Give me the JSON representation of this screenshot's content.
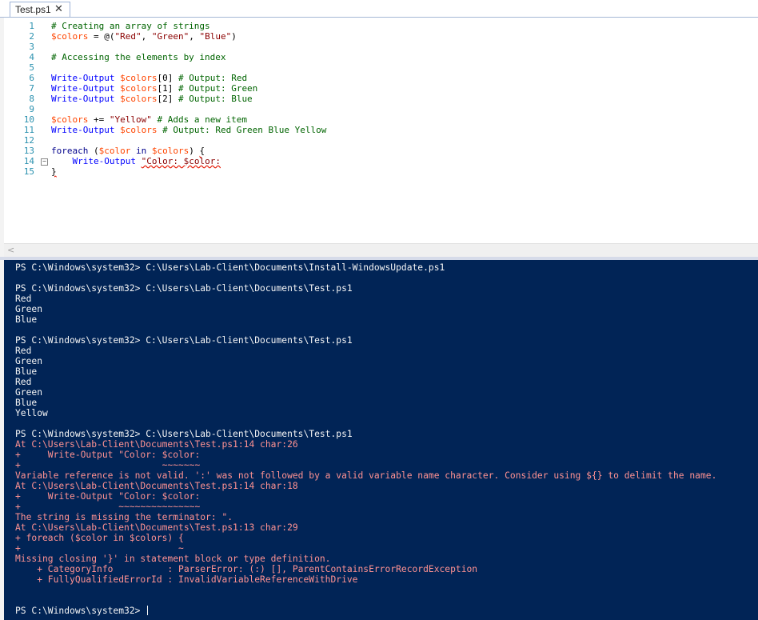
{
  "tab": {
    "label": "Test.ps1",
    "close_glyph": "✕"
  },
  "editor": {
    "line_numbers": [
      "1",
      "2",
      "3",
      "4",
      "5",
      "6",
      "7",
      "8",
      "9",
      "10",
      "11",
      "12",
      "13",
      "14",
      "15"
    ],
    "lines": [
      [
        {
          "t": "# Creating an array of strings",
          "c": "comment"
        }
      ],
      [
        {
          "t": "$colors",
          "c": "var"
        },
        {
          "t": " = @(",
          "c": "plain"
        },
        {
          "t": "\"Red\"",
          "c": "str"
        },
        {
          "t": ", ",
          "c": "plain"
        },
        {
          "t": "\"Green\"",
          "c": "str"
        },
        {
          "t": ", ",
          "c": "plain"
        },
        {
          "t": "\"Blue\"",
          "c": "str"
        },
        {
          "t": ")",
          "c": "plain"
        }
      ],
      [],
      [
        {
          "t": "# Accessing the elements by index",
          "c": "comment"
        }
      ],
      [],
      [
        {
          "t": "Write-Output",
          "c": "cmd"
        },
        {
          "t": " ",
          "c": "plain"
        },
        {
          "t": "$colors",
          "c": "var"
        },
        {
          "t": "[0] ",
          "c": "plain"
        },
        {
          "t": "# Output: Red",
          "c": "comment"
        }
      ],
      [
        {
          "t": "Write-Output",
          "c": "cmd"
        },
        {
          "t": " ",
          "c": "plain"
        },
        {
          "t": "$colors",
          "c": "var"
        },
        {
          "t": "[1] ",
          "c": "plain"
        },
        {
          "t": "# Output: Green",
          "c": "comment"
        }
      ],
      [
        {
          "t": "Write-Output",
          "c": "cmd"
        },
        {
          "t": " ",
          "c": "plain"
        },
        {
          "t": "$colors",
          "c": "var"
        },
        {
          "t": "[2] ",
          "c": "plain"
        },
        {
          "t": "# Output: Blue",
          "c": "comment"
        }
      ],
      [],
      [
        {
          "t": "$colors",
          "c": "var"
        },
        {
          "t": " += ",
          "c": "plain"
        },
        {
          "t": "\"Yellow\"",
          "c": "str"
        },
        {
          "t": " ",
          "c": "plain"
        },
        {
          "t": "# Adds a new item",
          "c": "comment"
        }
      ],
      [
        {
          "t": "Write-Output",
          "c": "cmd"
        },
        {
          "t": " ",
          "c": "plain"
        },
        {
          "t": "$colors",
          "c": "var"
        },
        {
          "t": " ",
          "c": "plain"
        },
        {
          "t": "# Output: Red Green Blue Yellow",
          "c": "comment"
        }
      ],
      [],
      [
        {
          "t": "foreach",
          "c": "kw"
        },
        {
          "t": " (",
          "c": "plain"
        },
        {
          "t": "$color",
          "c": "var"
        },
        {
          "t": " ",
          "c": "plain"
        },
        {
          "t": "in",
          "c": "kw"
        },
        {
          "t": " ",
          "c": "plain"
        },
        {
          "t": "$colors",
          "c": "var"
        },
        {
          "t": ") ",
          "c": "plain"
        },
        {
          "t": "{",
          "c": "err"
        }
      ],
      [
        {
          "t": "    ",
          "c": "plain"
        },
        {
          "t": "Write-Output",
          "c": "cmd"
        },
        {
          "t": " ",
          "c": "plain"
        },
        {
          "t": "\"Color: $color:",
          "c": "strerr"
        }
      ],
      [
        {
          "t": "}",
          "c": "err"
        }
      ]
    ],
    "fold_glyph": "−"
  },
  "scroll": {
    "left_arrow": "<"
  },
  "console": {
    "lines": [
      {
        "t": "PS C:\\Windows\\system32> C:\\Users\\Lab-Client\\Documents\\Install-WindowsUpdate.ps1",
        "k": "out"
      },
      {
        "t": "",
        "k": "out"
      },
      {
        "t": "PS C:\\Windows\\system32> C:\\Users\\Lab-Client\\Documents\\Test.ps1",
        "k": "out"
      },
      {
        "t": "Red",
        "k": "out"
      },
      {
        "t": "Green",
        "k": "out"
      },
      {
        "t": "Blue",
        "k": "out"
      },
      {
        "t": "",
        "k": "out"
      },
      {
        "t": "PS C:\\Windows\\system32> C:\\Users\\Lab-Client\\Documents\\Test.ps1",
        "k": "out"
      },
      {
        "t": "Red",
        "k": "out"
      },
      {
        "t": "Green",
        "k": "out"
      },
      {
        "t": "Blue",
        "k": "out"
      },
      {
        "t": "Red",
        "k": "out"
      },
      {
        "t": "Green",
        "k": "out"
      },
      {
        "t": "Blue",
        "k": "out"
      },
      {
        "t": "Yellow",
        "k": "out"
      },
      {
        "t": "",
        "k": "out"
      },
      {
        "t": "PS C:\\Windows\\system32> C:\\Users\\Lab-Client\\Documents\\Test.ps1",
        "k": "out"
      },
      {
        "t": "At C:\\Users\\Lab-Client\\Documents\\Test.ps1:14 char:26",
        "k": "err"
      },
      {
        "t": "+     Write-Output \"Color: $color:",
        "k": "err"
      },
      {
        "t": "+                          ~~~~~~~",
        "k": "err"
      },
      {
        "t": "Variable reference is not valid. ':' was not followed by a valid variable name character. Consider using ${} to delimit the name.",
        "k": "err"
      },
      {
        "t": "At C:\\Users\\Lab-Client\\Documents\\Test.ps1:14 char:18",
        "k": "err"
      },
      {
        "t": "+     Write-Output \"Color: $color:",
        "k": "err"
      },
      {
        "t": "+                  ~~~~~~~~~~~~~~~",
        "k": "err"
      },
      {
        "t": "The string is missing the terminator: \".",
        "k": "err"
      },
      {
        "t": "At C:\\Users\\Lab-Client\\Documents\\Test.ps1:13 char:29",
        "k": "err"
      },
      {
        "t": "+ foreach ($color in $colors) {",
        "k": "err"
      },
      {
        "t": "+                             ~",
        "k": "err"
      },
      {
        "t": "Missing closing '}' in statement block or type definition.",
        "k": "err"
      },
      {
        "t": "    + CategoryInfo          : ParserError: (:) [], ParentContainsErrorRecordException",
        "k": "err"
      },
      {
        "t": "    + FullyQualifiedErrorId : InvalidVariableReferenceWithDrive",
        "k": "err"
      },
      {
        "t": "",
        "k": "out"
      },
      {
        "t": "",
        "k": "out"
      },
      {
        "t": "PS C:\\Windows\\system32> ",
        "k": "prompt"
      }
    ]
  }
}
